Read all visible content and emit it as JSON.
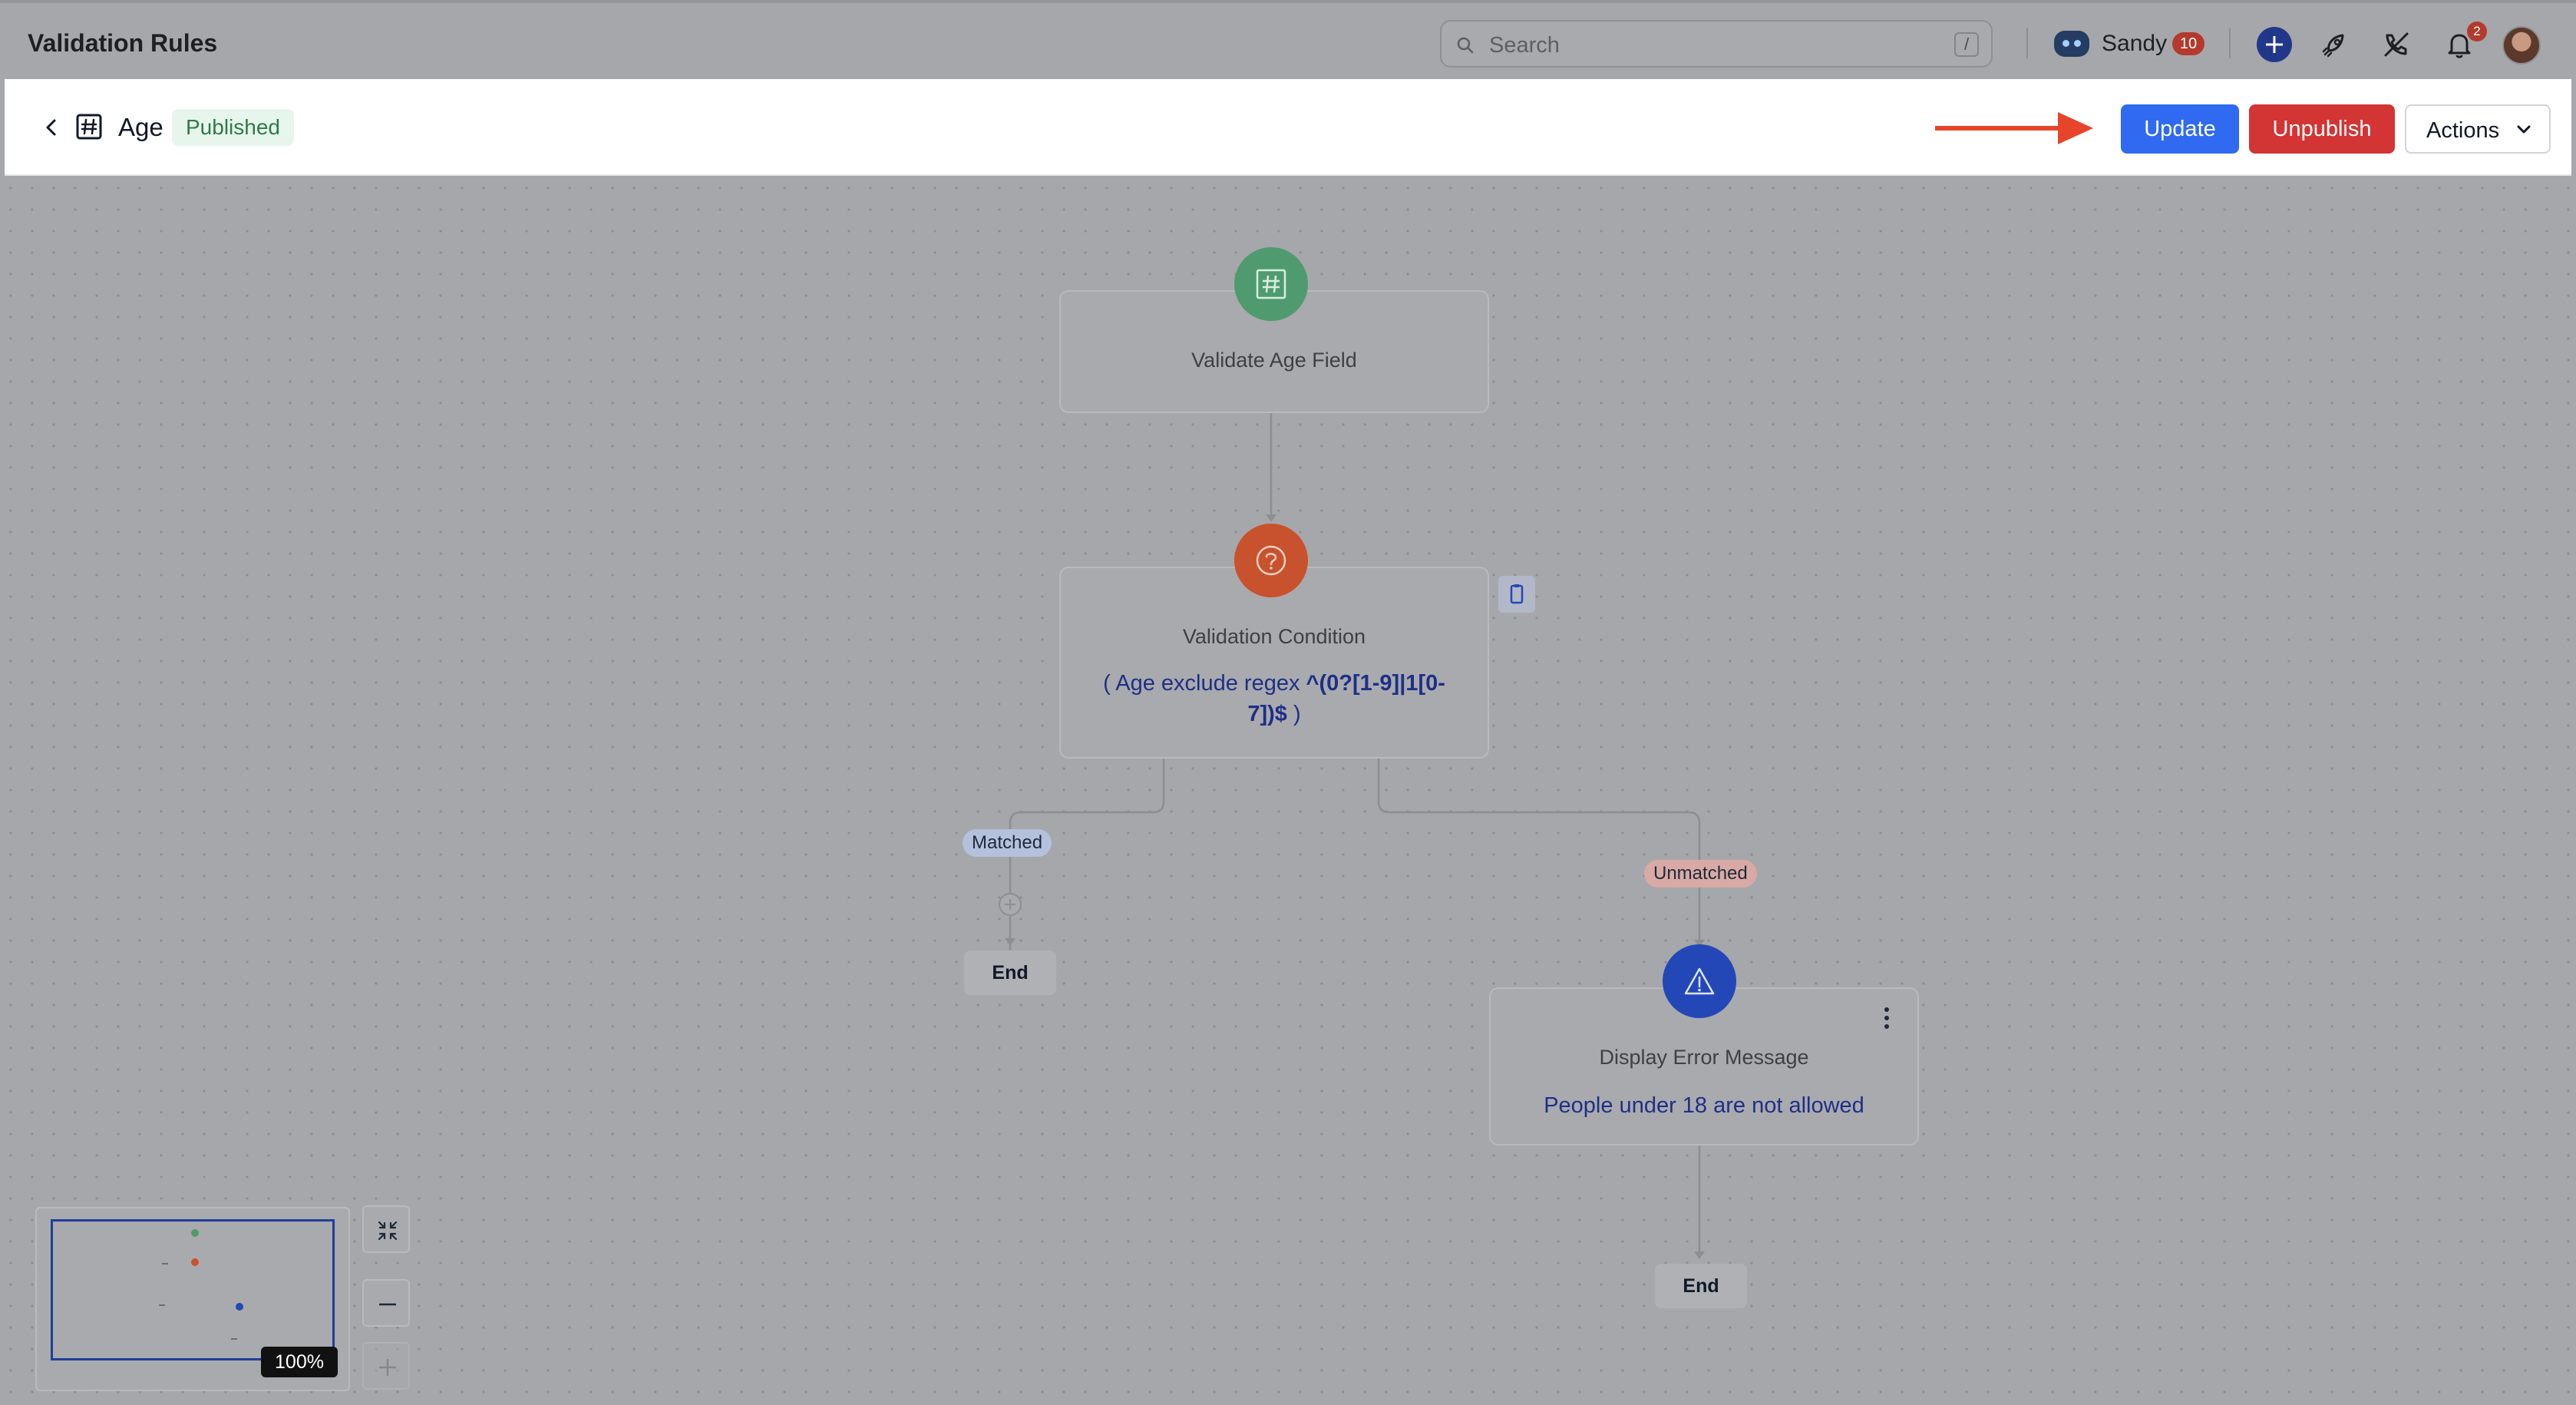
{
  "app": {
    "title": "Validation Rules"
  },
  "search": {
    "placeholder": "Search",
    "shortcut": "/"
  },
  "user": {
    "name": "Sandy",
    "badge_count": "10",
    "notification_count": "2"
  },
  "header": {
    "field_name": "Age",
    "status": "Published",
    "update_label": "Update",
    "unpublish_label": "Unpublish",
    "actions_label": "Actions"
  },
  "flow": {
    "trigger": {
      "title": "Validate Age Field",
      "icon": "hash-icon",
      "color": "#4f9b6f"
    },
    "condition": {
      "title": "Validation Condition",
      "open_paren": "(",
      "field": "Age",
      "operator": "exclude regex",
      "value_line1": "^(0?[1-9]|1[0-",
      "value_line2": "7])$",
      "close_paren": ")",
      "icon": "question-icon",
      "color": "#c8522e"
    },
    "matched_label": "Matched",
    "unmatched_label": "Unmatched",
    "matched_end": "End",
    "action": {
      "title": "Display Error Message",
      "message": "People under 18 are not allowed",
      "icon": "warning-icon",
      "color": "#2447b8"
    },
    "unmatched_end": "End"
  },
  "minimap": {
    "zoom": "100%"
  },
  "colors": {
    "accent": "#2f6af0",
    "danger": "#d33434",
    "success_bg": "#e7f6ec",
    "annotation_arrow": "#e8442c"
  }
}
